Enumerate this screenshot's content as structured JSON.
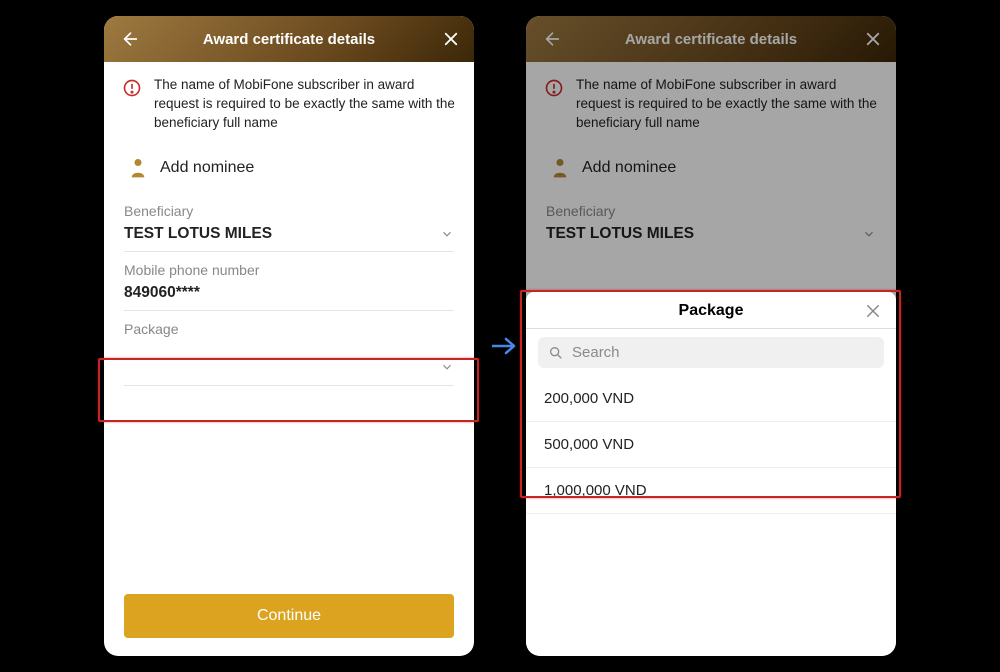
{
  "header": {
    "title": "Award certificate details"
  },
  "notice": "The name of MobiFone subscriber in award request is required to be exactly the same with the beneficiary full name",
  "add_nominee": "Add nominee",
  "fields": {
    "beneficiary_label": "Beneficiary",
    "beneficiary_value": "TEST LOTUS MILES",
    "phone_label": "Mobile phone number",
    "phone_value": "849060****",
    "package_label": "Package",
    "package_value": ""
  },
  "continue": "Continue",
  "sheet": {
    "title": "Package",
    "search_placeholder": "Search",
    "options": [
      "200,000 VND",
      "500,000 VND",
      "1,000,000 VND"
    ]
  }
}
